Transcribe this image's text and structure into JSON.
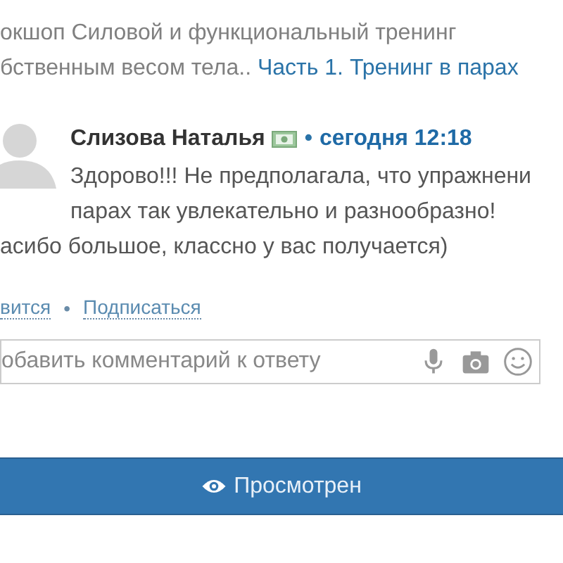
{
  "topic": {
    "lines": [
      "окшоп Силовой и функциональный тренинг",
      "бственным весом тела.."
    ],
    "link": "Часть 1. Тренинг в парах"
  },
  "comment": {
    "author": "Слизова Наталья",
    "separator": "•",
    "time": "сегодня 12:18",
    "lines": [
      "Здорово!!! Не предполагала, что упражнени",
      "парах так увлекательно и разнообразно!",
      "асибо большое, классно у вас получается)"
    ],
    "actions": [
      "вится",
      "Подписаться"
    ],
    "action_separator": "•"
  },
  "reply_field": {
    "placeholder": "обавить комментарий к ответу"
  },
  "status_button": {
    "label": "Просмотрен"
  }
}
